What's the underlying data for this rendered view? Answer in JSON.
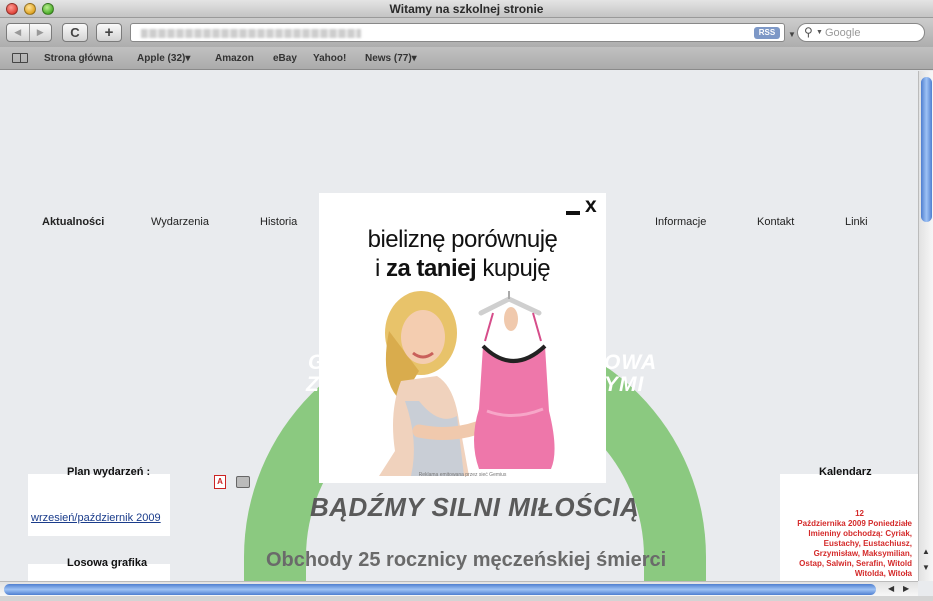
{
  "window": {
    "title": "Witamy na szkolnej stronie"
  },
  "toolbar": {
    "reload_glyph": "C",
    "add_glyph": "+",
    "rss_label": "RSS",
    "search_placeholder": "Google"
  },
  "bookmarks": {
    "items": [
      "Strona główna",
      "Apple (32)▾",
      "Amazon",
      "eBay",
      "Yahoo!",
      "News (77)▾"
    ]
  },
  "nav": {
    "items": [
      "Aktualności",
      "Wydarzenia",
      "Historia",
      "Informacje",
      "Kontakt",
      "Linki"
    ]
  },
  "banner": {
    "left_top": "G",
    "left_bottom": "Z",
    "right_top": "OWA",
    "right_bottom": "YMI"
  },
  "left_panel": {
    "events_title": "Plan wydarzeń :",
    "events_link": "wrzesień/październik 2009",
    "graphic_title": "Losowa grafika"
  },
  "icons": {
    "pdf_glyph": "A"
  },
  "article": {
    "headline": "BĄDŹMY SILNI MIŁOŚCIĄ",
    "subhead": "Obchody 25 rocznicy męczeńskiej śmierci"
  },
  "calendar": {
    "title": "Kalendarz",
    "lines": [
      "12",
      "Października 2009 Poniedziałe",
      "Imieniny obchodzą: Cyriak,",
      "Eustachy, Eustachiusz,",
      "Grzymisław, Maksymilian,",
      "Ostap, Salwin, Serafin, Witold",
      "Witolda, Witoła"
    ]
  },
  "ad": {
    "close_glyph": "x",
    "line1": "bieliznę porównuję",
    "line2_pre": "i ",
    "line2_bold": "za taniej",
    "line2_post": " kupuję",
    "footer": "Reklama emitowana przez sieć Gemius"
  },
  "colors": {
    "accent_green": "#8bc980",
    "calendar_red": "#d42a2a",
    "link_blue": "#1a3c8b",
    "scroll_blue": "#4f7fd0"
  }
}
